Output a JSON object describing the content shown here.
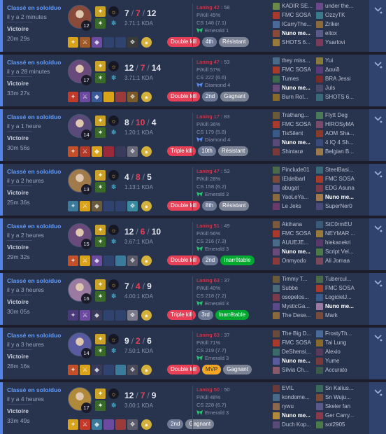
{
  "matches": [
    {
      "queue": "Classé en solo/duo",
      "ago": "il y a 2 minutes",
      "result": "Victoire",
      "duration": "20m 29s",
      "champion_color": "#8a4a3a",
      "level": "12",
      "kills": "7",
      "deaths": "7",
      "assists": "12",
      "kda": "2.71:1 KDA",
      "lane": "Laning 42",
      "lane_score": ": 58",
      "pkill": "P/Kill 45%",
      "cs": "CS 146 (7.1)",
      "rank": "Emerald 1",
      "rank_color": "#2fbf71",
      "badges": [
        {
          "label": "Double kill",
          "cls": "b-kill"
        },
        {
          "label": "4th",
          "cls": "b-place"
        },
        {
          "label": "Résistant",
          "cls": "b-tag"
        }
      ],
      "items": [
        "#d9a21b",
        "#9f5a2a",
        "#6b4aa0",
        "#2f436e",
        "#2f436e",
        "#3a3a3a",
        "#d4b13a"
      ],
      "team1": [
        {
          "name": "KADIR SE...",
          "color": "#6b8a4a",
          "me": false
        },
        {
          "name": "FMC SOSA",
          "color": "#a83a2a",
          "me": false
        },
        {
          "name": "ICarryThe...",
          "color": "#4a6a9a",
          "me": false
        },
        {
          "name": "Nuno me...",
          "color": "#8a4a3a",
          "me": true
        },
        {
          "name": "SHOTS 6...",
          "color": "#9a7a3a",
          "me": false
        }
      ],
      "team2": [
        {
          "name": "under the...",
          "color": "#6a4a8a",
          "me": false
        },
        {
          "name": "OzzyTK",
          "color": "#3a7a8a",
          "me": false
        },
        {
          "name": "Zriker",
          "color": "#8a6a3a",
          "me": false
        },
        {
          "name": "eitox",
          "color": "#5a5a8a",
          "me": false
        },
        {
          "name": "Ysarlovi",
          "color": "#7a3a5a",
          "me": false
        }
      ]
    },
    {
      "queue": "Classé en solo/duo",
      "ago": "il y a 28 minutes",
      "result": "Victoire",
      "duration": "33m 27s",
      "champion_color": "#6a4a7a",
      "level": "17",
      "kills": "12",
      "deaths": "7",
      "assists": "14",
      "kda": "3.71:1 KDA",
      "lane": "Laning 47",
      "lane_score": ": 53",
      "pkill": "P/Kill 57%",
      "cs": "CS 222 (6.6)",
      "rank": "Diamond 4",
      "rank_color": "#5a8ae8",
      "badges": [
        {
          "label": "Double kill",
          "cls": "b-kill"
        },
        {
          "label": "2nd",
          "cls": "b-place"
        },
        {
          "label": "Gagnant",
          "cls": "b-tag"
        }
      ],
      "items": [
        "#c43a2a",
        "#6b4aa0",
        "#3a5a9a",
        "#d9a21b",
        "#9a3a3a",
        "#7a5a2a",
        "#d4b13a"
      ],
      "team1": [
        {
          "name": "they miss...",
          "color": "#4a6a8a",
          "me": false
        },
        {
          "name": "FMC SOSA",
          "color": "#a83a2a",
          "me": false
        },
        {
          "name": "Tumes",
          "color": "#3a6a4a",
          "me": false
        },
        {
          "name": "Nuno me...",
          "color": "#6a4a7a",
          "me": true
        },
        {
          "name": "Burn Rol...",
          "color": "#8a6a2a",
          "me": false
        }
      ],
      "team2": [
        {
          "name": "Yui",
          "color": "#8a7a3a",
          "me": false
        },
        {
          "name": "Δαυίδ",
          "color": "#5a3a7a",
          "me": false
        },
        {
          "name": "BRA Jessi",
          "color": "#7a2a2a",
          "me": false
        },
        {
          "name": "Juls",
          "color": "#4a4a6a",
          "me": false
        },
        {
          "name": "SHOTS 6...",
          "color": "#3a6a7a",
          "me": false
        }
      ]
    },
    {
      "queue": "Classé en solo/duo",
      "ago": "il y a 1 heure",
      "result": "Victoire",
      "duration": "30m 56s",
      "champion_color": "#5a4a7a",
      "level": "14",
      "kills": "8",
      "deaths": "10",
      "assists": "4",
      "kda": "1.20:1 KDA",
      "lane": "Laning 17",
      "lane_score": ": 83",
      "pkill": "P/Kill 36%",
      "cs": "CS 179 (5.8)",
      "rank": "Diamond 4",
      "rank_color": "#5a8ae8",
      "badges": [
        {
          "label": "Triple kill",
          "cls": "b-kill"
        },
        {
          "label": "10th",
          "cls": "b-place"
        },
        {
          "label": "Résistant",
          "cls": "b-tag"
        }
      ],
      "items": [
        "#c4502a",
        "#b03a2a",
        "#d9a21b",
        "#9a2a3a",
        "#3a3a5a",
        "#6a6a7a",
        "#d4b13a"
      ],
      "team1": [
        {
          "name": "Trathang...",
          "color": "#6a5a3a",
          "me": false
        },
        {
          "name": "FMC SOSA",
          "color": "#a83a2a",
          "me": false
        },
        {
          "name": "TisSilent",
          "color": "#3a5a8a",
          "me": false
        },
        {
          "name": "Nuno me...",
          "color": "#5a4a7a",
          "me": true
        },
        {
          "name": "Shintarø",
          "color": "#7a3a3a",
          "me": false
        }
      ],
      "team2": [
        {
          "name": "Flytt Deg",
          "color": "#4a7a5a",
          "me": false
        },
        {
          "name": "HIROSyMA",
          "color": "#7a4a6a",
          "me": false
        },
        {
          "name": "AOM Sha...",
          "color": "#8a3a2a",
          "me": false
        },
        {
          "name": "4 IQ 4 Sh...",
          "color": "#3a4a7a",
          "me": false
        },
        {
          "name": "Belgian B...",
          "color": "#9a7a4a",
          "me": false
        }
      ]
    },
    {
      "queue": "Classé en solo/duo",
      "ago": "il y a 2 heures",
      "result": "Victoire",
      "duration": "25m 36s",
      "champion_color": "#a07a4a",
      "level": "13",
      "kills": "4",
      "deaths": "8",
      "assists": "5",
      "kda": "1.13:1 KDA",
      "lane": "Laning 47",
      "lane_score": ": 53",
      "pkill": "P/Kill 28%",
      "cs": "CS 158 (6.2)",
      "rank": "Emerald 3",
      "rank_color": "#2fbf71",
      "badges": [
        {
          "label": "Double kill",
          "cls": "b-kill"
        },
        {
          "label": "8th",
          "cls": "b-place"
        },
        {
          "label": "Résistant",
          "cls": "b-tag"
        }
      ],
      "items": [
        "#3a7a9a",
        "#d9a21b",
        "#6a5a3a",
        "#2f436e",
        "#2f436e",
        "#3a8aa0",
        "#d4b13a"
      ],
      "team1": [
        {
          "name": "Pinclude01",
          "color": "#4a6a4a",
          "me": false
        },
        {
          "name": "IEldelbarl",
          "color": "#7a4a3a",
          "me": false
        },
        {
          "name": "abugat",
          "color": "#5a5a8a",
          "me": false
        },
        {
          "name": "YaoLeYa...",
          "color": "#8a6a3a",
          "me": false
        },
        {
          "name": "Le Jeks",
          "color": "#6a3a6a",
          "me": false
        }
      ],
      "team2": [
        {
          "name": "SteelBasi...",
          "color": "#3a6a7a",
          "me": false
        },
        {
          "name": "FMC SOSA",
          "color": "#a83a2a",
          "me": false
        },
        {
          "name": "EDG Asuna",
          "color": "#7a3a4a",
          "me": false
        },
        {
          "name": "Nuno me...",
          "color": "#a07a4a",
          "me": true
        },
        {
          "name": "SuperNer0",
          "color": "#4a4a7a",
          "me": false
        }
      ]
    },
    {
      "queue": "Classé en solo/duo",
      "ago": "il y a 2 heures",
      "result": "Victoire",
      "duration": "29m 32s",
      "champion_color": "#6a4a7a",
      "level": "15",
      "kills": "12",
      "deaths": "6",
      "assists": "10",
      "kda": "3.67:1 KDA",
      "lane": "Laning 51",
      "lane_score": ": 49",
      "pkill": "P/Kill 56%",
      "cs": "CS 216 (7.3)",
      "rank": "Emerald 3",
      "rank_color": "#2fbf71",
      "badges": [
        {
          "label": "Double kill",
          "cls": "b-kill"
        },
        {
          "label": "2nd",
          "cls": "b-place"
        },
        {
          "label": "Inarrêtable",
          "cls": "b-good"
        }
      ],
      "items": [
        "#c4502a",
        "#d9a21b",
        "#6b4aa0",
        "#2f436e",
        "#3a7a9a",
        "#5a5a6a",
        "#d4b13a"
      ],
      "team1": [
        {
          "name": "Akihana",
          "color": "#7a5a3a",
          "me": false
        },
        {
          "name": "FMC SOSA",
          "color": "#a83a2a",
          "me": false
        },
        {
          "name": "AUUEJE...",
          "color": "#4a6a8a",
          "me": false
        },
        {
          "name": "Nuno me...",
          "color": "#6a4a7a",
          "me": true
        },
        {
          "name": "Onmyodo",
          "color": "#8a3a3a",
          "me": false
        }
      ],
      "team2": [
        {
          "name": "StC0rmEU",
          "color": "#3a5a7a",
          "me": false
        },
        {
          "name": "NEYMAR ...",
          "color": "#9a7a3a",
          "me": false
        },
        {
          "name": "hiekanekri",
          "color": "#5a3a6a",
          "me": false
        },
        {
          "name": "Script Vel...",
          "color": "#4a7a4a",
          "me": false
        },
        {
          "name": "Ali Jomaa",
          "color": "#7a4a5a",
          "me": false
        }
      ]
    },
    {
      "queue": "Classé en solo/duo",
      "ago": "il y a 3 heures",
      "result": "Victoire",
      "duration": "30m 05s",
      "champion_color": "#9a7aa0",
      "level": "16",
      "kills": "7",
      "deaths": "4",
      "assists": "9",
      "kda": "4.00:1 KDA",
      "lane": "Laning 63",
      "lane_score": ": 37",
      "pkill": "P/Kill 40%",
      "cs": "CS 218 (7.2)",
      "rank": "Emerald 3",
      "rank_color": "#2fbf71",
      "badges": [
        {
          "label": "Triple kill",
          "cls": "b-kill"
        },
        {
          "label": "3rd",
          "cls": "b-place"
        },
        {
          "label": "Inarrêtable",
          "cls": "b-good"
        }
      ],
      "items": [
        "#4a3a7a",
        "#6b4aa0",
        "#3a3a5a",
        "#2f436e",
        "#2f436e",
        "#7a7a8a",
        "#d4b13a"
      ],
      "team1": [
        {
          "name": "Timmy T...",
          "color": "#6a5a3a",
          "me": false
        },
        {
          "name": "Subbe",
          "color": "#4a6a7a",
          "me": false
        },
        {
          "name": "osopelos...",
          "color": "#7a3a4a",
          "me": false
        },
        {
          "name": "MysticGa...",
          "color": "#5a4a8a",
          "me": false
        },
        {
          "name": "The Dese...",
          "color": "#8a6a3a",
          "me": false
        }
      ],
      "team2": [
        {
          "name": "Tubercul...",
          "color": "#4a6a4a",
          "me": false
        },
        {
          "name": "FMC SOSA",
          "color": "#a83a2a",
          "me": false
        },
        {
          "name": "LogicielJ...",
          "color": "#3a5a8a",
          "me": false
        },
        {
          "name": "Nuno me...",
          "color": "#9a7aa0",
          "me": true
        },
        {
          "name": "Mark",
          "color": "#7a4a3a",
          "me": false
        }
      ]
    },
    {
      "queue": "Classé en solo/duo",
      "ago": "il y a 3 heures",
      "result": "Victoire",
      "duration": "28m 16s",
      "champion_color": "#5a5aa0",
      "level": "14",
      "kills": "9",
      "deaths": "2",
      "assists": "6",
      "kda": "7.50:1 KDA",
      "lane": "Laning 63",
      "lane_score": ": 37",
      "pkill": "P/Kill 71%",
      "cs": "CS 219 (7.7)",
      "rank": "Emerald 3",
      "rank_color": "#2fbf71",
      "badges": [
        {
          "label": "Double kill",
          "cls": "b-kill"
        },
        {
          "label": "MVP",
          "cls": "b-mvp"
        },
        {
          "label": "Gagnant",
          "cls": "b-tag"
        }
      ],
      "items": [
        "#c4502a",
        "#d9a21b",
        "#3a3a5a",
        "#2f436e",
        "#3a7a9a",
        "#4a4a5a",
        "#d4b13a"
      ],
      "team1": [
        {
          "name": "The Big D...",
          "color": "#6a4a3a",
          "me": false
        },
        {
          "name": "FMC SOSA",
          "color": "#a83a2a",
          "me": false
        },
        {
          "name": "DeShensi...",
          "color": "#3a6a6a",
          "me": false
        },
        {
          "name": "Nuno me...",
          "color": "#5a5aa0",
          "me": true
        },
        {
          "name": "Silvia Ch...",
          "color": "#8a5a6a",
          "me": false
        }
      ],
      "team2": [
        {
          "name": "FrostyTh...",
          "color": "#4a6a9a",
          "me": false
        },
        {
          "name": "Tai Lung",
          "color": "#8a6a2a",
          "me": false
        },
        {
          "name": "Alexio",
          "color": "#5a3a5a",
          "me": false
        },
        {
          "name": "Yume",
          "color": "#7a3a3a",
          "me": false
        },
        {
          "name": "Accurato",
          "color": "#3a5a4a",
          "me": false
        }
      ]
    },
    {
      "queue": "Classé en solo/duo",
      "ago": "il y a 4 heures",
      "result": "Victoire",
      "duration": "33m 49s",
      "champion_color": "#b08a3a",
      "level": "17",
      "kills": "12",
      "deaths": "7",
      "assists": "9",
      "kda": "3.00:1 KDA",
      "lane": "Laning 50",
      "lane_score": ": 50",
      "pkill": "P/Kill 48%",
      "cs": "CS 228 (6.7)",
      "rank": "Emerald 3",
      "rank_color": "#2fbf71",
      "badges": [
        {
          "label": "2nd",
          "cls": "b-place"
        },
        {
          "label": "Gagnant",
          "cls": "b-tag"
        }
      ],
      "items": [
        "#d9a21b",
        "#c43a2a",
        "#3a7a9a",
        "#6b4aa0",
        "#9a3a3a",
        "#5a5a6a",
        "#d4b13a"
      ],
      "team1": [
        {
          "name": "EVIL",
          "color": "#6a3a3a",
          "me": false
        },
        {
          "name": "kondome...",
          "color": "#4a6a8a",
          "me": false
        },
        {
          "name": "rywu",
          "color": "#8a6a4a",
          "me": false
        },
        {
          "name": "Nuno me...",
          "color": "#b08a3a",
          "me": true
        },
        {
          "name": "Duch Kop...",
          "color": "#5a4a7a",
          "me": false
        }
      ],
      "team2": [
        {
          "name": "Sn Kalius...",
          "color": "#3a6a5a",
          "me": false
        },
        {
          "name": "Sn Wuju...",
          "color": "#7a4a3a",
          "me": false
        },
        {
          "name": "Skeler fan",
          "color": "#5a5a8a",
          "me": false
        },
        {
          "name": "Ger Carry...",
          "color": "#8a3a4a",
          "me": false
        },
        {
          "name": "sot2905",
          "color": "#4a7a4a",
          "me": false
        }
      ]
    }
  ]
}
